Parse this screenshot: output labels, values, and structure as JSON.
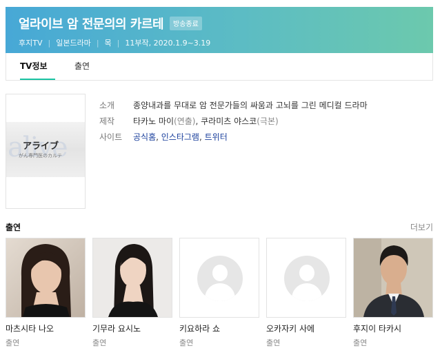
{
  "header": {
    "title": "얼라이브 암 전문의의 카르테",
    "badge": "방송종료",
    "meta": [
      "후지TV",
      "일본드라마",
      "목",
      "11부작, 2020.1.9~3.19"
    ]
  },
  "tabs": [
    {
      "label": "TV정보",
      "active": true
    },
    {
      "label": "출연",
      "active": false
    }
  ],
  "poster": {
    "bg_word": "alive",
    "title_jp": "アライブ",
    "subtitle_jp": "がん専門医のカルテ"
  },
  "info": {
    "intro_label": "소개",
    "intro_value": "종양내과를 무대로 암 전문가들의 싸움과 고뇌를 그린 메디컬 드라마",
    "production_label": "제작",
    "production": {
      "director": "타카노 마이",
      "director_role": "(연출)",
      "writer": "쿠라미츠 야스코",
      "writer_role": "(극본)"
    },
    "site_label": "사이트",
    "sites": [
      "공식홈",
      "인스타그램",
      "트위터"
    ]
  },
  "cast_section": {
    "title": "출연",
    "more": "더보기",
    "items": [
      {
        "name": "마츠시타 나오",
        "role": "출연",
        "photo": "actress-photo"
      },
      {
        "name": "기무라 요시노",
        "role": "출연",
        "photo": "actress-photo"
      },
      {
        "name": "키요하라 쇼",
        "role": "출연",
        "photo": "placeholder"
      },
      {
        "name": "오카자키 사에",
        "role": "출연",
        "photo": "placeholder"
      },
      {
        "name": "후지이 타카시",
        "role": "출연",
        "photo": "actor-photo"
      }
    ]
  },
  "colors": {
    "header_gradient_start": "#47a8d6",
    "header_gradient_end": "#6cc9ad",
    "tab_underline": "#18c3a2",
    "link": "#1a3f9c"
  }
}
